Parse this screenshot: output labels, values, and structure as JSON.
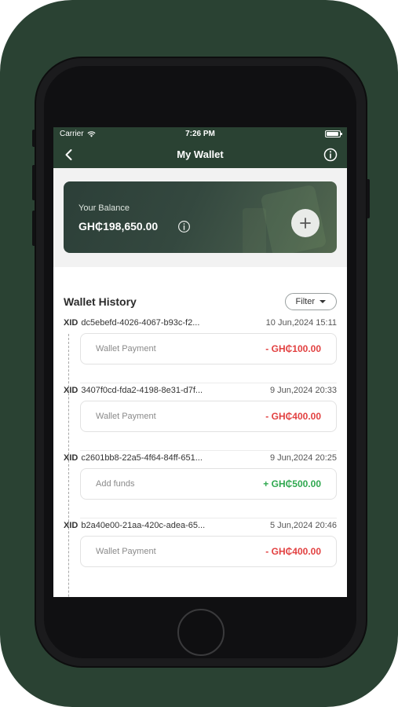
{
  "status": {
    "carrier": "Carrier",
    "time": "7:26 PM"
  },
  "nav": {
    "title": "My Wallet",
    "back_icon": "chevron-left-icon",
    "info_icon": "info-icon"
  },
  "balance": {
    "label": "Your Balance",
    "amount": "GH₵198,650.00"
  },
  "history": {
    "title": "Wallet History",
    "filter_label": "Filter",
    "transactions": [
      {
        "prefix": "XID",
        "id": "dc5ebefd-4026-4067-b93c-f2...",
        "date": "10 Jun,2024 15:11",
        "type": "Wallet Payment",
        "amount": "- GH₵100.00",
        "direction": "debit"
      },
      {
        "prefix": "XID",
        "id": "3407f0cd-fda2-4198-8e31-d7f...",
        "date": "9 Jun,2024 20:33",
        "type": "Wallet Payment",
        "amount": "- GH₵400.00",
        "direction": "debit"
      },
      {
        "prefix": "XID",
        "id": "c2601bb8-22a5-4f64-84ff-651...",
        "date": "9 Jun,2024 20:25",
        "type": "Add funds",
        "amount": "+ GH₵500.00",
        "direction": "credit"
      },
      {
        "prefix": "XID",
        "id": "b2a40e00-21aa-420c-adea-65...",
        "date": "5 Jun,2024 20:46",
        "type": "Wallet Payment",
        "amount": "- GH₵400.00",
        "direction": "debit"
      }
    ]
  },
  "colors": {
    "frame": "#2a4233",
    "debit": "#e24141",
    "credit": "#2fa84f"
  }
}
